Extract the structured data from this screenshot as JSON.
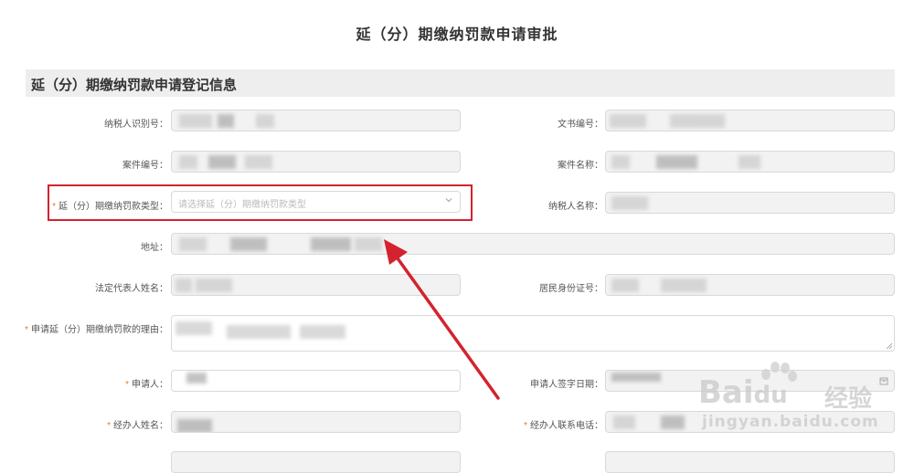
{
  "page": {
    "title": "延（分）期缴纳罚款申请审批"
  },
  "section": {
    "title": "延（分）期缴纳罚款申请登记信息"
  },
  "form": {
    "taxpayer_id_label": "纳税人识别号：",
    "document_no_label": "文书编号：",
    "case_no_label": "案件编号：",
    "case_name_label": "案件名称：",
    "fine_type_label": "延（分）期缴纳罚款类型：",
    "fine_type_placeholder": "请选择延（分）期缴纳罚款类型",
    "taxpayer_name_label": "纳税人名称：",
    "address_label": "地址：",
    "legal_rep_label": "法定代表人姓名：",
    "resident_id_label": "居民身份证号：",
    "reason_label": "申请延（分）期缴纳罚款的理由：",
    "applicant_label": "申请人：",
    "applicant_sign_date_label": "申请人签字日期：",
    "handler_name_label": "经办人姓名：",
    "handler_phone_label": "经办人联系电话：",
    "required_mark": "*"
  },
  "watermark": {
    "brand": "Bai",
    "brand_tail": "du",
    "cn": "经验",
    "url": "jingyan.baidu.com"
  },
  "colors": {
    "highlight_border": "#d3232f",
    "arrow": "#d3232f",
    "required": "#e8772b",
    "section_bg": "#eeeeee",
    "field_bg": "#f2f2f2"
  },
  "icons": {
    "select_chevron": "chevron-down-icon",
    "date_picker": "calendar-icon",
    "textarea_resize": "resize-handle-icon"
  }
}
